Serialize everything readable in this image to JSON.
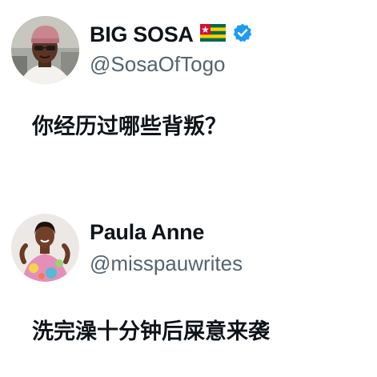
{
  "tweets": [
    {
      "display_name": "BIG SOSA",
      "handle": "@SosaOfTogo",
      "text": "你经历过哪些背叛？",
      "flag": "togo-flag-icon",
      "verified": "verified-badge-icon",
      "colors": {
        "verified": "#1d9bf0",
        "handle": "#536471"
      }
    },
    {
      "display_name": "Paula Anne",
      "handle": "@misspauwrites",
      "text": "洗完澡十分钟后屎意来袭"
    }
  ]
}
